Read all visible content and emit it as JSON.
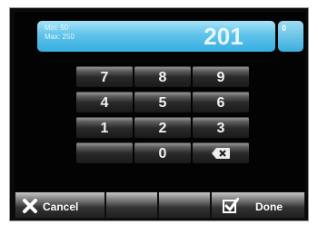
{
  "display": {
    "min_label": "Min: 50",
    "max_label": "Max: 250",
    "value": "201",
    "unit_value": "0"
  },
  "keypad": {
    "keys": [
      "7",
      "8",
      "9",
      "4",
      "5",
      "6",
      "1",
      "2",
      "3",
      "",
      "0"
    ],
    "backspace_icon": "backspace-icon"
  },
  "bottom_bar": {
    "cancel_label": "Cancel",
    "done_label": "Done",
    "cancel_icon": "close-icon",
    "done_icon": "check-icon"
  },
  "colors": {
    "display_blue": "#3aaedf",
    "key_dark": "#1a1a1a"
  }
}
